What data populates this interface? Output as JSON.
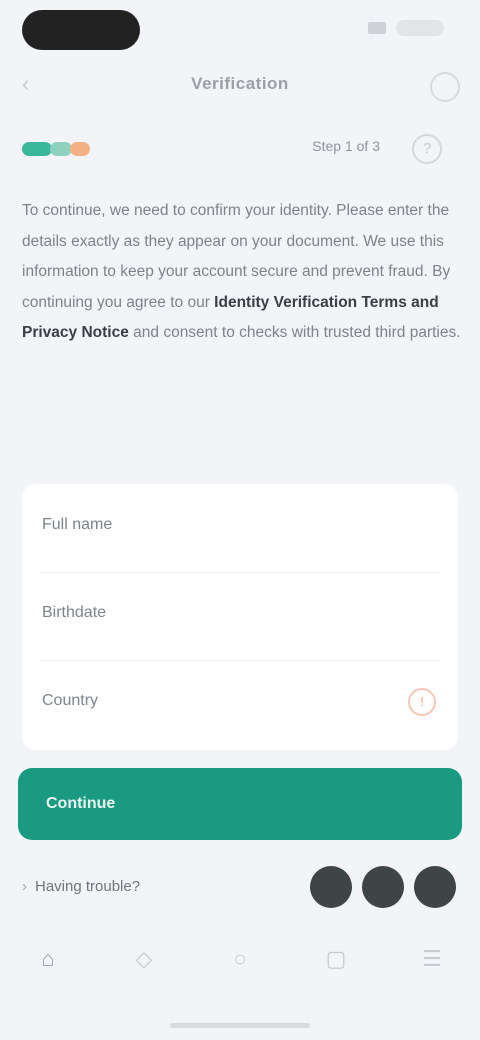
{
  "status_bar": {
    "time": "",
    "battery": ""
  },
  "nav": {
    "title": "Verification",
    "back_icon": "chevron-left-icon",
    "action_icon": "more-icon"
  },
  "progress": {
    "step_label": "Step 1 of 3",
    "help_icon": "?",
    "segments": [
      {
        "color": "#39b79a"
      },
      {
        "color": "#8fd1bf"
      },
      {
        "color": "#f4b183"
      }
    ]
  },
  "intro": {
    "text_before": "To continue, we need to confirm your identity. Please enter the details exactly as they appear on your document. We use this information to keep your account secure and prevent fraud. By continuing you agree to our ",
    "bold_text": "Identity Verification Terms and Privacy Notice",
    "text_after": " and consent to checks with trusted third parties."
  },
  "form": {
    "fields": [
      {
        "label": "Full name",
        "placeholder": "",
        "value": ""
      },
      {
        "label": "Birthdate",
        "placeholder": "",
        "value": ""
      },
      {
        "label": "Country",
        "placeholder": "",
        "value": ""
      }
    ],
    "warning_icon": "!"
  },
  "primary_button": {
    "label": "Continue"
  },
  "secondary": {
    "link_label": "Having trouble?",
    "chevron": "›"
  },
  "socials": [
    {
      "icon": "apple-icon"
    },
    {
      "icon": "google-icon"
    },
    {
      "icon": "facebook-icon"
    }
  ],
  "tabs": [
    {
      "label": "",
      "icon": "⌂"
    },
    {
      "label": "",
      "icon": "◇"
    },
    {
      "label": "",
      "icon": "○"
    },
    {
      "label": "",
      "icon": "▢"
    },
    {
      "label": "",
      "icon": "☰"
    }
  ]
}
